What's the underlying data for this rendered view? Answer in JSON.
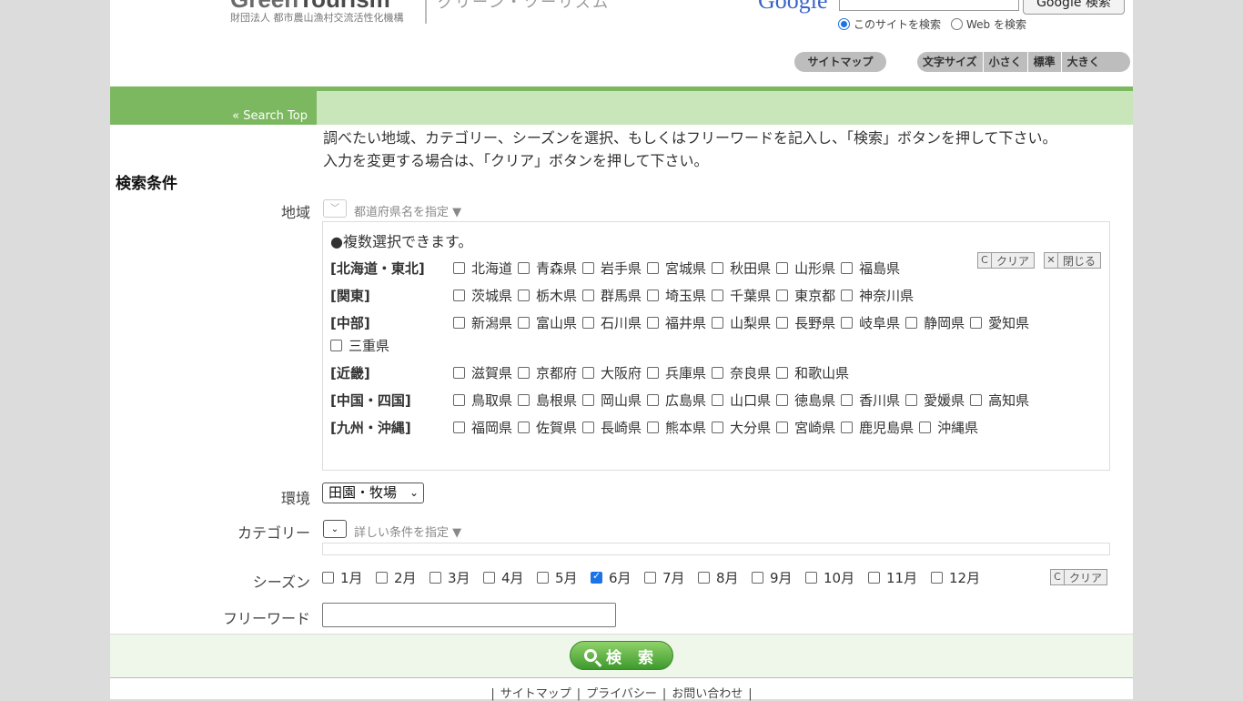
{
  "header": {
    "logo_main_a": "Green",
    "logo_main_b": "Tourism",
    "logo_sub": "財団法人 都市農山漁村交流活性化機構",
    "logo_jp": "グリーン・ツーリズム",
    "google_logo": "Google",
    "google_button": "Google 検索",
    "radio_site": "このサイトを検索",
    "radio_web": "Web を検索",
    "sitemap": "サイトマップ",
    "font_size_label": "文字サイズ",
    "font_small": "小さく",
    "font_normal": "標準",
    "font_large": "大きく"
  },
  "nav": {
    "search_top": "« Search Top"
  },
  "intro": {
    "line1": "調べたい地域、カテゴリー、シーズンを選択、もしくはフリーワードを記入し、「検索」ボタンを押して下さい。",
    "line2": "入力を変更する場合は、「クリア」ボタンを押して下さい。"
  },
  "conditions_title": "検索条件",
  "region": {
    "label": "地域",
    "hint": "都道府県名を指定",
    "multi_note": "●複数選択できます。",
    "clear": "クリア",
    "close": "閉じる",
    "groups": [
      {
        "name": "[北海道・東北]",
        "prefs": [
          "北海道",
          "青森県",
          "岩手県",
          "宮城県",
          "秋田県",
          "山形県",
          "福島県"
        ]
      },
      {
        "name": "[関東]",
        "prefs": [
          "茨城県",
          "栃木県",
          "群馬県",
          "埼玉県",
          "千葉県",
          "東京都",
          "神奈川県"
        ]
      },
      {
        "name": "[中部]",
        "prefs": [
          "新潟県",
          "富山県",
          "石川県",
          "福井県",
          "山梨県",
          "長野県",
          "岐阜県",
          "静岡県",
          "愛知県",
          "三重県"
        ]
      },
      {
        "name": "[近畿]",
        "prefs": [
          "滋賀県",
          "京都府",
          "大阪府",
          "兵庫県",
          "奈良県",
          "和歌山県"
        ]
      },
      {
        "name": "[中国・四国]",
        "prefs": [
          "鳥取県",
          "島根県",
          "岡山県",
          "広島県",
          "山口県",
          "徳島県",
          "香川県",
          "愛媛県",
          "高知県"
        ]
      },
      {
        "name": "[九州・沖縄]",
        "prefs": [
          "福岡県",
          "佐賀県",
          "長崎県",
          "熊本県",
          "大分県",
          "宮崎県",
          "鹿児島県",
          "沖縄県"
        ]
      }
    ]
  },
  "environment": {
    "label": "環境",
    "selected": "田園・牧場"
  },
  "category": {
    "label": "カテゴリー",
    "hint": "詳しい条件を指定"
  },
  "season": {
    "label": "シーズン",
    "clear": "クリア",
    "months": [
      "1月",
      "2月",
      "3月",
      "4月",
      "5月",
      "6月",
      "7月",
      "8月",
      "9月",
      "10月",
      "11月",
      "12月"
    ],
    "checked": "6月"
  },
  "freeword": {
    "label": "フリーワード",
    "value": ""
  },
  "search_button": "検 索",
  "footer": {
    "links": [
      "サイトマップ",
      "プライバシー",
      "お問い合わせ"
    ]
  }
}
